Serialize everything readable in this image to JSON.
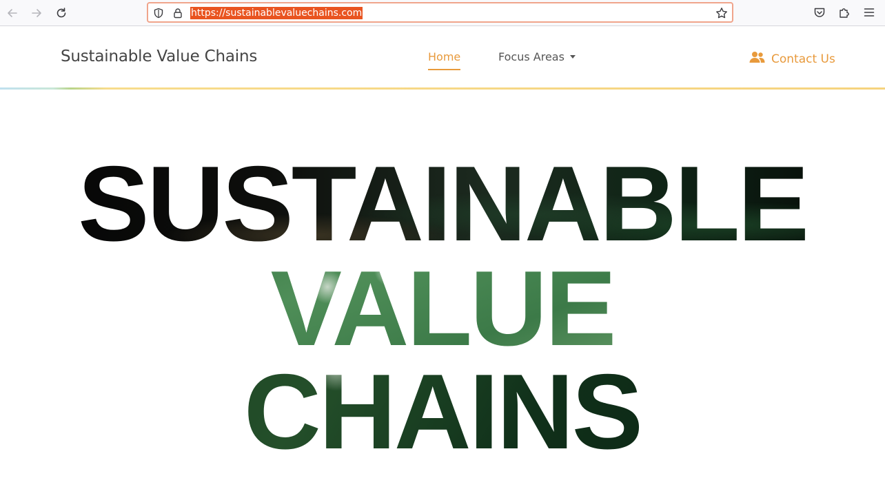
{
  "browser": {
    "url": "https://sustainablevaluechains.com"
  },
  "header": {
    "brand": "Sustainable Value Chains",
    "nav": {
      "home_label": "Home",
      "focus_label": "Focus Areas",
      "contact_label": "Contact Us"
    }
  },
  "hero": {
    "line1": "SUSTAINABLE",
    "line2": "VALUE",
    "line3": "CHAINS"
  },
  "colors": {
    "accent": "#e89a3c",
    "url_highlight": "#e95420"
  },
  "icons": [
    "back-arrow-icon",
    "forward-arrow-icon",
    "reload-icon",
    "shield-icon",
    "lock-icon",
    "star-icon",
    "pocket-icon",
    "extensions-icon",
    "menu-icon",
    "users-icon",
    "caret-down-icon"
  ]
}
